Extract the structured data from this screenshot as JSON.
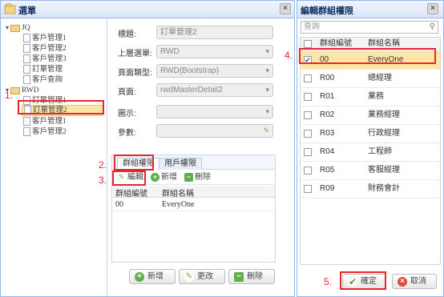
{
  "left_window": {
    "title": "選單",
    "tree": [
      {
        "label": "JQ",
        "type": "folder",
        "level": 0
      },
      {
        "label": "客戶管理1",
        "type": "file",
        "level": 1
      },
      {
        "label": "客戶管理2",
        "type": "file",
        "level": 1
      },
      {
        "label": "客戶管理3",
        "type": "file",
        "level": 1
      },
      {
        "label": "訂單管理",
        "type": "file",
        "level": 1
      },
      {
        "label": "客戶查詢",
        "type": "file",
        "level": 1
      },
      {
        "label": "RWD",
        "type": "folder",
        "level": 0
      },
      {
        "label": "訂單管理1",
        "type": "file",
        "level": 1
      },
      {
        "label": "訂單管理2",
        "type": "file",
        "level": 1,
        "selected": true
      },
      {
        "label": "客戶管理1",
        "type": "file",
        "level": 1
      },
      {
        "label": "客戶管理2",
        "type": "file",
        "level": 1
      }
    ],
    "form": {
      "title_label": "標題:",
      "title_value": "訂單管理2",
      "parent_label": "上層選單:",
      "parent_value": "RWD",
      "pagetype_label": "頁面類型:",
      "pagetype_value": "RWD(Bootstrap)",
      "page_label": "頁面:",
      "page_value": "rwdMasterDetail2",
      "icon_label": "圖示:",
      "icon_value": "",
      "param_label": "參數:",
      "param_value": ""
    },
    "tabs": [
      "群組權限",
      "用戶權限"
    ],
    "toolbar": {
      "edit": "編輯",
      "add": "新增",
      "delete": "刪除"
    },
    "grid": {
      "columns": [
        "群組編號",
        "群組名稱"
      ],
      "rows": [
        [
          "00",
          "EveryOne"
        ]
      ]
    },
    "buttons": {
      "add": "新增",
      "update": "更改",
      "delete": "刪除"
    }
  },
  "right_window": {
    "title": "編輯群組權限",
    "search_placeholder": "查詢",
    "columns": [
      "群組編號",
      "群組名稱"
    ],
    "rows": [
      {
        "id": "00",
        "name": "EveryOne",
        "checked": true
      },
      {
        "id": "R00",
        "name": "總經理",
        "checked": false
      },
      {
        "id": "R01",
        "name": "業務",
        "checked": false
      },
      {
        "id": "R02",
        "name": "業務經理",
        "checked": false
      },
      {
        "id": "R03",
        "name": "行政經理",
        "checked": false
      },
      {
        "id": "R04",
        "name": "工程師",
        "checked": false
      },
      {
        "id": "R05",
        "name": "客服經理",
        "checked": false
      },
      {
        "id": "R09",
        "name": "財務會計",
        "checked": false
      }
    ],
    "ok_label": "確定",
    "cancel_label": "取消"
  },
  "annotations": [
    "1.",
    "2.",
    "3.",
    "4.",
    "5."
  ],
  "colors": {
    "annotation": "#e8262b",
    "selected": "#fbe6a6",
    "border": "#95b8e7"
  }
}
